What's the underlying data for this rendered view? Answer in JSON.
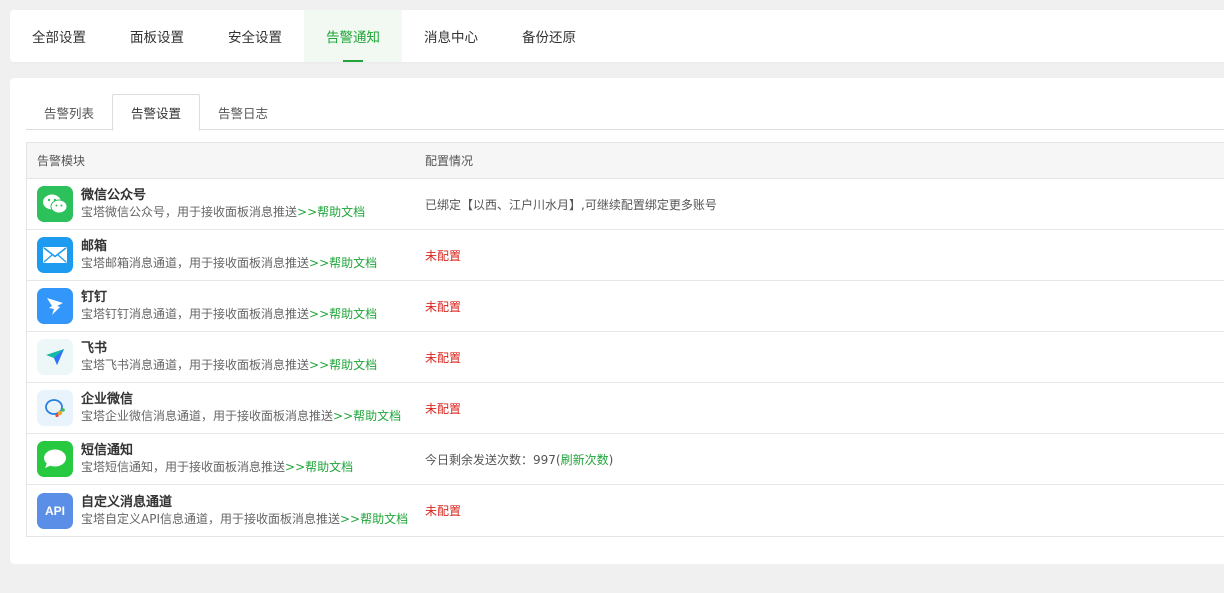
{
  "top_tabs": [
    "全部设置",
    "面板设置",
    "安全设置",
    "告警通知",
    "消息中心",
    "备份还原"
  ],
  "sub_tabs": [
    "告警列表",
    "告警设置",
    "告警日志"
  ],
  "table": {
    "headers": [
      "告警模块",
      "配置情况"
    ],
    "rows": [
      {
        "name": "微信公众号",
        "desc": "宝塔微信公众号，用于接收面板消息推送",
        "help": ">>帮助文档",
        "status": "已绑定【以西、江户川水月】,可继续配置绑定更多账号"
      },
      {
        "name": "邮箱",
        "desc": "宝塔邮箱消息通道，用于接收面板消息推送",
        "help": ">>帮助文档",
        "status": "未配置"
      },
      {
        "name": "钉钉",
        "desc": "宝塔钉钉消息通道，用于接收面板消息推送",
        "help": ">>帮助文档",
        "status": "未配置"
      },
      {
        "name": "飞书",
        "desc": "宝塔飞书消息通道，用于接收面板消息推送",
        "help": ">>帮助文档",
        "status": "未配置"
      },
      {
        "name": "企业微信",
        "desc": "宝塔企业微信消息通道，用于接收面板消息推送",
        "help": ">>帮助文档",
        "status": "未配置"
      },
      {
        "name": "短信通知",
        "desc": "宝塔短信通知，用于接收面板消息推送",
        "help": ">>帮助文档",
        "status_prefix": "今日剩余发送次数：997(",
        "status_link": "刷新次数",
        "status_suffix": ")"
      },
      {
        "name": "自定义消息通道",
        "desc": "宝塔自定义API信息通道，用于接收面板消息推送",
        "help": ">>帮助文档",
        "status": "未配置",
        "icon_text": "API"
      }
    ]
  },
  "icons": [
    "wechat-icon",
    "mail-icon",
    "dingtalk-icon",
    "feishu-icon",
    "wecom-icon",
    "sms-icon",
    "api-icon"
  ],
  "colors": {
    "accent": "#20a53a",
    "unset": "#d9251e"
  }
}
